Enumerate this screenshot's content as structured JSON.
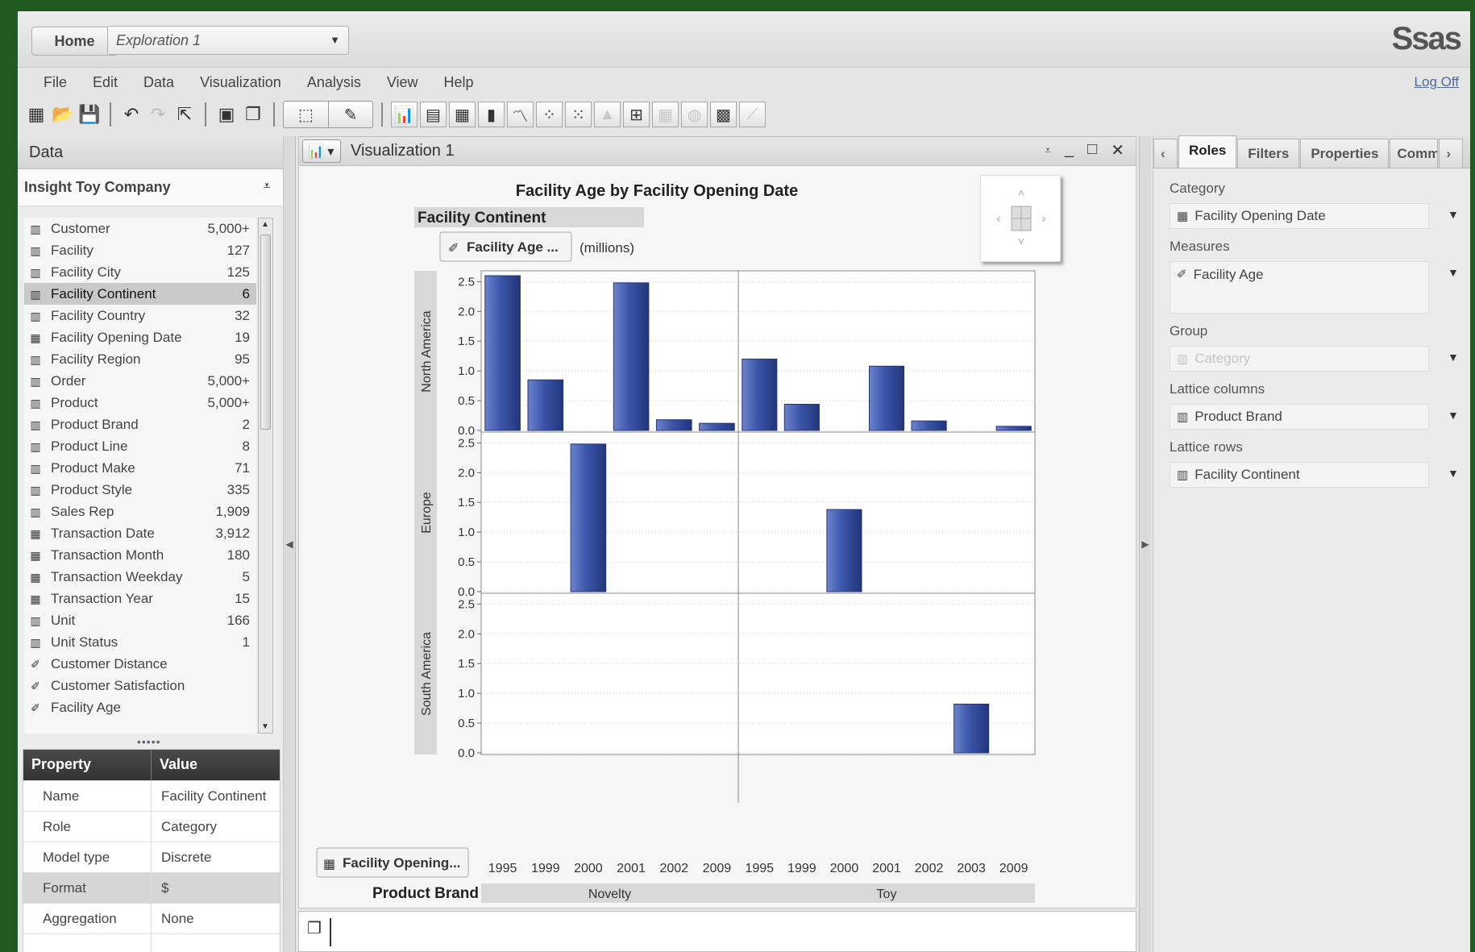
{
  "header": {
    "home_label": "Home",
    "exploration_title": "Exploration 1",
    "logo": "Ssas",
    "logoff": "Log Off"
  },
  "menu": [
    "File",
    "Edit",
    "Data",
    "Visualization",
    "Analysis",
    "View",
    "Help"
  ],
  "data_panel": {
    "title": "Data",
    "source": "Insight Toy Company",
    "items": [
      {
        "name": "Customer",
        "count": "5,000+",
        "icon": "category-icon"
      },
      {
        "name": "Facility",
        "count": "127",
        "icon": "category-icon"
      },
      {
        "name": "Facility City",
        "count": "125",
        "icon": "category-icon"
      },
      {
        "name": "Facility Continent",
        "count": "6",
        "icon": "category-icon",
        "selected": true
      },
      {
        "name": "Facility Country",
        "count": "32",
        "icon": "category-icon"
      },
      {
        "name": "Facility Opening Date",
        "count": "19",
        "icon": "date-icon"
      },
      {
        "name": "Facility Region",
        "count": "95",
        "icon": "category-icon"
      },
      {
        "name": "Order",
        "count": "5,000+",
        "icon": "category-icon"
      },
      {
        "name": "Product",
        "count": "5,000+",
        "icon": "category-icon"
      },
      {
        "name": "Product Brand",
        "count": "2",
        "icon": "category-icon"
      },
      {
        "name": "Product Line",
        "count": "8",
        "icon": "category-icon"
      },
      {
        "name": "Product Make",
        "count": "71",
        "icon": "category-icon"
      },
      {
        "name": "Product Style",
        "count": "335",
        "icon": "category-icon"
      },
      {
        "name": "Sales Rep",
        "count": "1,909",
        "icon": "category-icon"
      },
      {
        "name": "Transaction Date",
        "count": "3,912",
        "icon": "date-icon"
      },
      {
        "name": "Transaction Month",
        "count": "180",
        "icon": "date-icon"
      },
      {
        "name": "Transaction Weekday",
        "count": "5",
        "icon": "date-icon"
      },
      {
        "name": "Transaction Year",
        "count": "15",
        "icon": "date-icon"
      },
      {
        "name": "Unit",
        "count": "166",
        "icon": "category-icon"
      },
      {
        "name": "Unit Status",
        "count": "1",
        "icon": "category-icon"
      },
      {
        "name": "Customer Distance",
        "count": "",
        "icon": "measure-icon"
      },
      {
        "name": "Customer Satisfaction",
        "count": "",
        "icon": "measure-icon"
      },
      {
        "name": "Facility Age",
        "count": "",
        "icon": "measure-icon"
      }
    ],
    "props_header": {
      "property": "Property",
      "value": "Value"
    },
    "props": [
      {
        "property": "Name",
        "value": "Facility Continent"
      },
      {
        "property": "Role",
        "value": "Category"
      },
      {
        "property": "Model type",
        "value": "Discrete"
      },
      {
        "property": "Format",
        "value": "$"
      },
      {
        "property": "Aggregation",
        "value": "None"
      }
    ]
  },
  "visualization": {
    "title": "Visualization 1"
  },
  "chart_data": {
    "type": "bar",
    "title": "Facility Age by Facility Opening Date",
    "lattice_rows_label": "Facility Continent",
    "lattice_columns_label": "Product Brand",
    "measure_button": "Facility Age ...",
    "measure_units": "(millions)",
    "category_button": "Facility Opening...",
    "rows": [
      "North America",
      "Europe",
      "South America"
    ],
    "columns": [
      {
        "name": "Novelty",
        "categories": [
          "1995",
          "1999",
          "2000",
          "2001",
          "2002",
          "2009"
        ]
      },
      {
        "name": "Toy",
        "categories": [
          "1995",
          "1999",
          "2000",
          "2001",
          "2002",
          "2003",
          "2009"
        ]
      }
    ],
    "ylim": [
      0,
      2.6
    ],
    "yticks": [
      "0.0",
      "0.5",
      "1.0",
      "1.5",
      "2.0",
      "2.5"
    ],
    "values": {
      "North America": {
        "Novelty": [
          2.6,
          0.85,
          0,
          2.48,
          0.18,
          0.12
        ],
        "Toy": [
          1.2,
          0.44,
          0,
          1.08,
          0.16,
          0,
          0.07
        ]
      },
      "Europe": {
        "Novelty": [
          0,
          0,
          2.48,
          0,
          0,
          0
        ],
        "Toy": [
          0,
          0,
          1.38,
          0,
          0,
          0,
          0
        ]
      },
      "South America": {
        "Novelty": [
          0,
          0,
          0,
          0,
          0,
          0
        ],
        "Toy": [
          0,
          0,
          0,
          0,
          0,
          0.82,
          0
        ]
      }
    },
    "bar_color": "#3a55a8",
    "grid": true
  },
  "right_panel": {
    "tabs": [
      "Roles",
      "Filters",
      "Properties",
      "Comm"
    ],
    "roles": [
      {
        "label": "Category",
        "value": "Facility Opening Date",
        "icon": "date-icon"
      },
      {
        "label": "Measures",
        "value": "Facility Age",
        "icon": "measure-icon"
      },
      {
        "label": "Group",
        "value": "Category",
        "icon": "category-icon",
        "disabled": true
      },
      {
        "label": "Lattice columns",
        "value": "Product Brand",
        "icon": "category-icon"
      },
      {
        "label": "Lattice rows",
        "value": "Facility Continent",
        "icon": "category-icon"
      }
    ]
  }
}
